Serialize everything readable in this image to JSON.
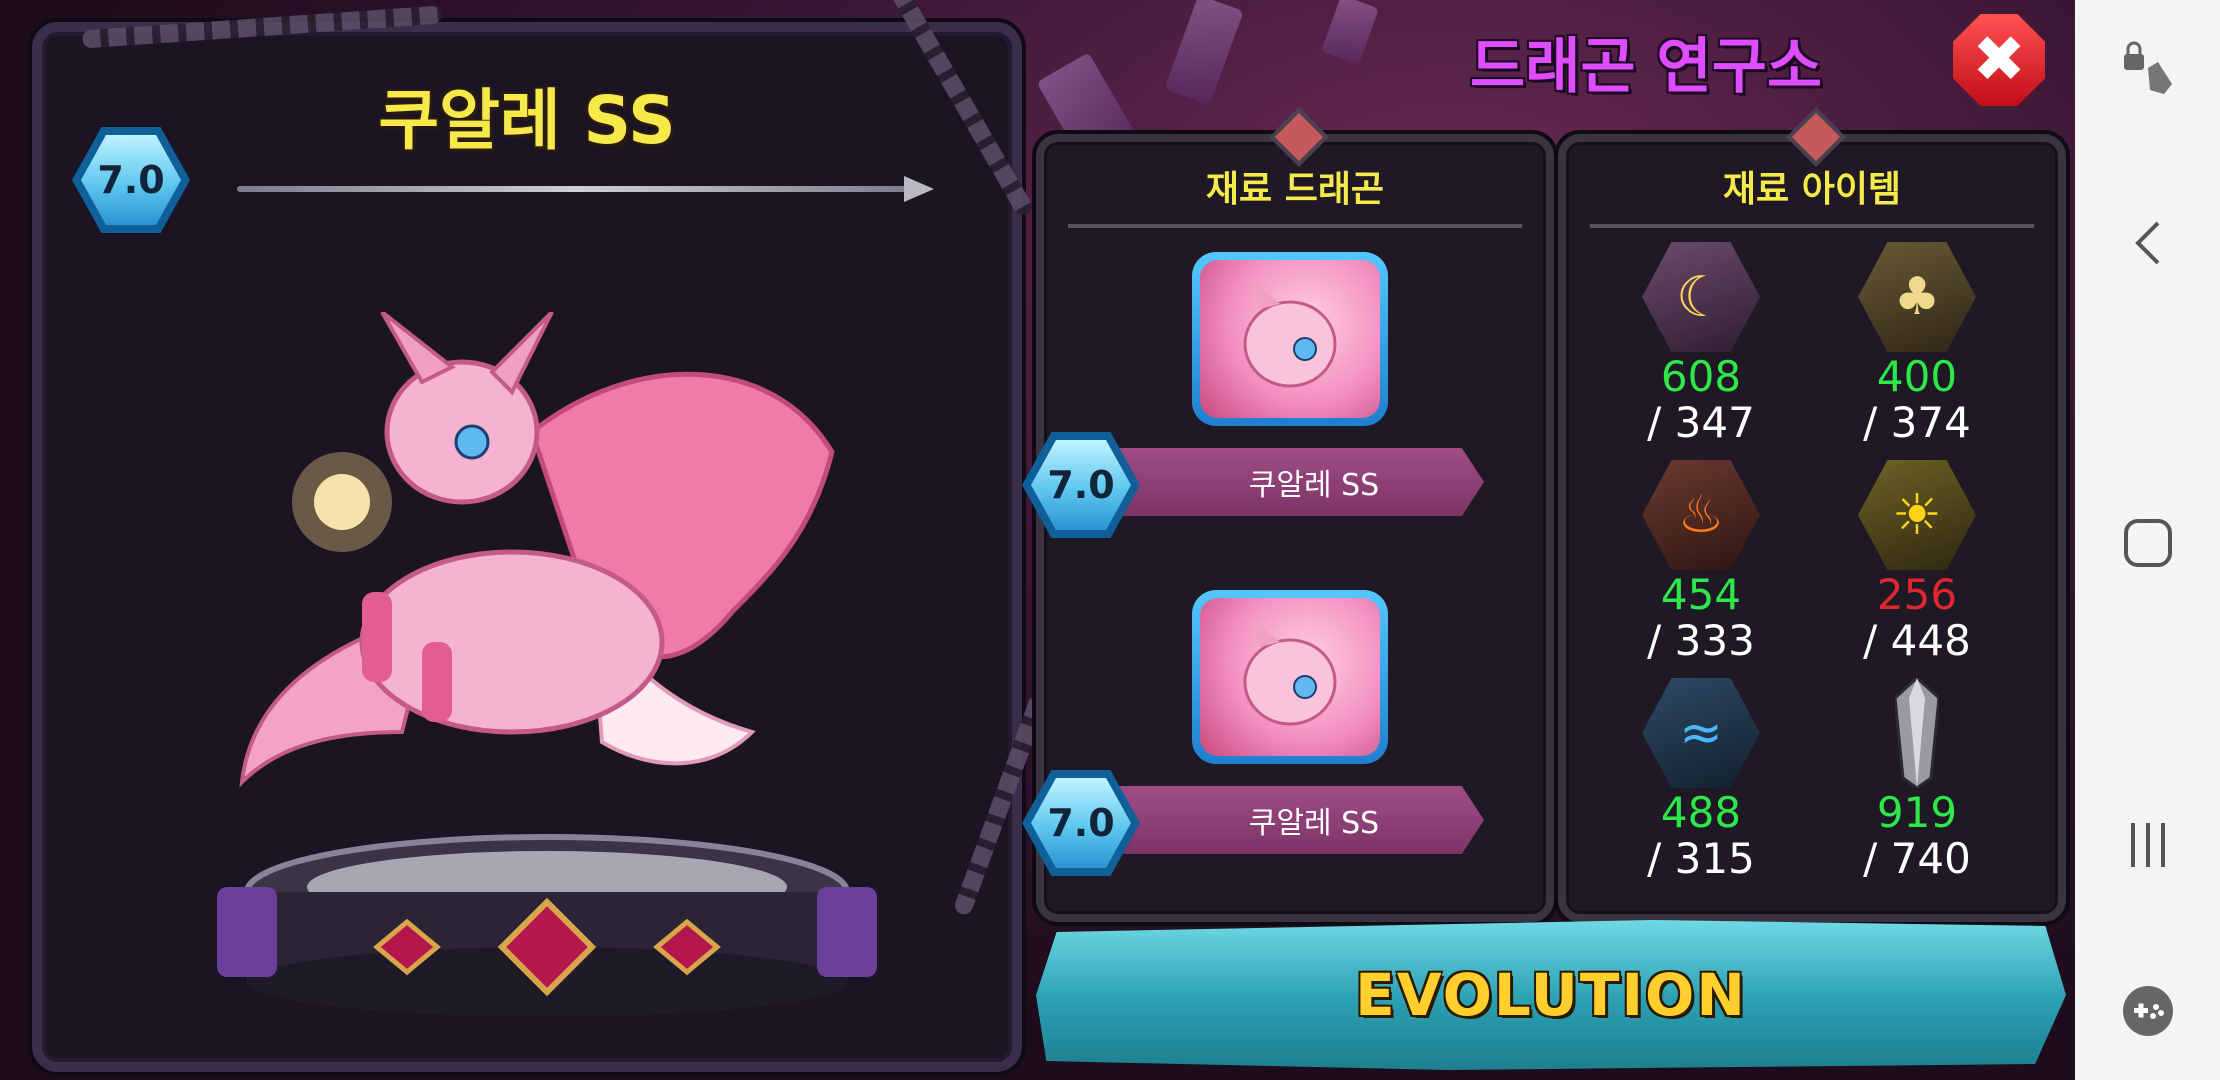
{
  "game": {
    "title": "드래곤 연구소",
    "close_glyph": "✖",
    "showcase": {
      "dragon_name": "쿠알레 SS",
      "level": "7.0"
    },
    "material_dragons": {
      "header": "재료 드래곤",
      "slots": [
        {
          "level": "7.0",
          "name": "쿠알레 SS"
        },
        {
          "level": "7.0",
          "name": "쿠알레 SS"
        }
      ]
    },
    "material_items": {
      "header": "재료 아이템",
      "items": [
        {
          "icon": "moon-element-icon",
          "have": "608",
          "need": "/ 347",
          "color": "#2ee84a"
        },
        {
          "icon": "tree-element-icon",
          "have": "400",
          "need": "/ 374",
          "color": "#2ee84a"
        },
        {
          "icon": "fire-element-icon",
          "have": "454",
          "need": "/ 333",
          "color": "#2ee84a"
        },
        {
          "icon": "sun-element-icon",
          "have": "256",
          "need": "/ 448",
          "color": "#e0262e"
        },
        {
          "icon": "water-element-icon",
          "have": "488",
          "need": "/ 315",
          "color": "#2ee84a"
        },
        {
          "icon": "crystal-icon",
          "have": "919",
          "need": "/ 740",
          "color": "#2ee84a"
        }
      ]
    },
    "evolution_label": "EVOLUTION"
  },
  "navbar": {
    "icons": [
      "touch-lock-icon",
      "back-icon",
      "home-icon",
      "recents-icon",
      "game-tools-icon"
    ]
  }
}
